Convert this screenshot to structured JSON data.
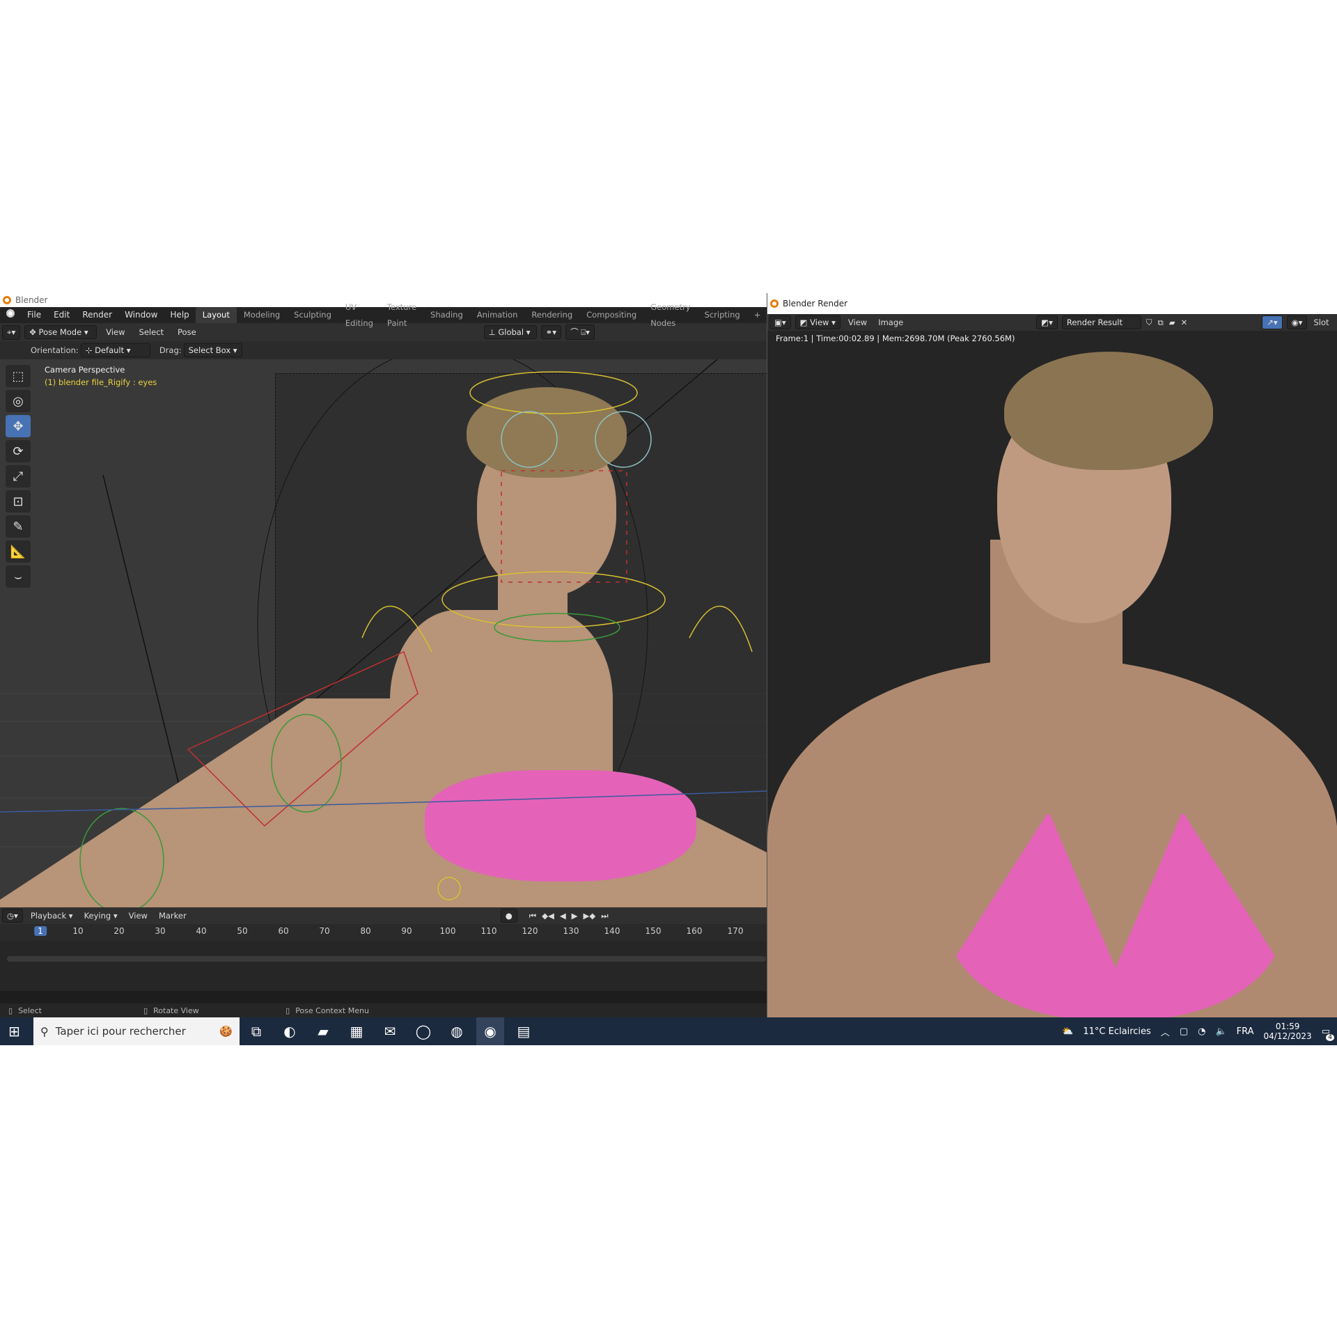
{
  "blender": {
    "window_title": "Blender",
    "menu": [
      "File",
      "Edit",
      "Render",
      "Window",
      "Help"
    ],
    "workspaces": [
      "Layout",
      "Modeling",
      "Sculpting",
      "UV Editing",
      "Texture Paint",
      "Shading",
      "Animation",
      "Rendering",
      "Compositing",
      "Geometry Nodes",
      "Scripting"
    ],
    "header": {
      "mode": "Pose Mode",
      "menus": [
        "View",
        "Select",
        "Pose"
      ],
      "transform_orientation": "Global"
    },
    "tool_options": {
      "orientation_label": "Orientation:",
      "orientation_value": "Default",
      "drag_label": "Drag:",
      "drag_value": "Select Box"
    },
    "viewport": {
      "view_name": "Camera Perspective",
      "active_object": "(1) blender file_Rigify : eyes"
    },
    "timeline": {
      "menus": [
        "Playback",
        "Keying",
        "View",
        "Marker"
      ],
      "current_frame": "1",
      "ticks": [
        "10",
        "20",
        "30",
        "40",
        "50",
        "60",
        "70",
        "80",
        "90",
        "100",
        "110",
        "120",
        "130",
        "140",
        "150",
        "160",
        "170"
      ]
    },
    "status": {
      "select": "Select",
      "rotate": "Rotate View",
      "context": "Pose Context Menu"
    }
  },
  "render": {
    "window_title": "Blender Render",
    "menus": [
      "View",
      "View",
      "Image"
    ],
    "image_name": "Render Result",
    "slot_label": "Slot",
    "stats": "Frame:1 | Time:00:02.89 | Mem:2698.70M (Peak 2760.56M)"
  },
  "taskbar": {
    "search_placeholder": "Taper ici pour rechercher",
    "weather": "11°C  Eclaircies",
    "language": "FRA",
    "time": "01:59",
    "date": "04/12/2023",
    "notifications": "4"
  },
  "colors": {
    "active_blue": "#4772b3",
    "blender_orange": "#e87d0d",
    "bikini_pink": "#e463b8",
    "rig_yellow": "#d8c030",
    "rig_red": "#c03030",
    "rig_green": "#3a9a3a"
  }
}
